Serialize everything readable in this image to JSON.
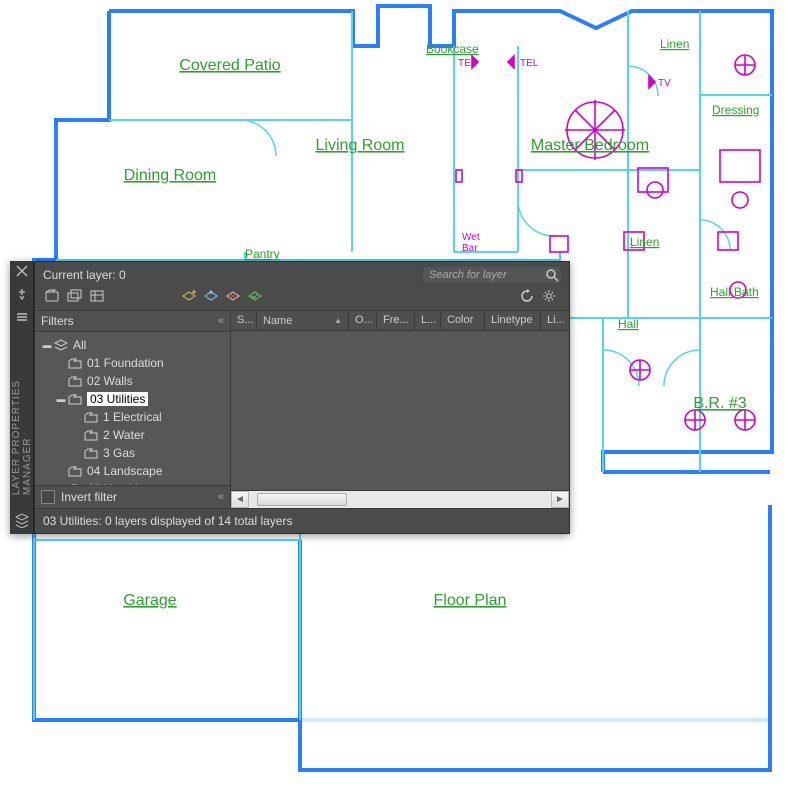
{
  "rooms": {
    "covered_patio": "Covered Patio",
    "living_room": "Living Room",
    "master_bedroom": "Master Bedroom",
    "dining_room": "Dining Room",
    "garage": "Garage",
    "floor_plan": "Floor Plan",
    "dressing": "Dressing",
    "hall_bath": "Hall Bath",
    "hall": "Hall",
    "br3": "B.R. #3",
    "linen1": "Linen",
    "linen2": "Linen",
    "bookcase": "Bookcase",
    "pantry": "Pantry",
    "wet_bar": "Wet\nBar",
    "tv": "TV",
    "tel1": "TEL",
    "tel2": "TEL"
  },
  "panel": {
    "title": "LAYER PROPERTIES MANAGER",
    "current_layer": "Current layer: 0",
    "search_placeholder": "Search for layer",
    "filters_heading": "Filters",
    "invert_filter": "Invert filter",
    "status": "03 Utilities: 0 layers displayed of 14 total layers",
    "tooltips": {
      "close": "Close",
      "pin": "Auto-hide",
      "menu": "Menu",
      "new_group": "New Group Filter",
      "new_prop": "New Property Filter",
      "states": "Layer States Manager",
      "new_layer": "New Layer",
      "new_frozen": "New Layer Frozen VP",
      "delete_layer": "Delete Layer",
      "set_current": "Set Current",
      "refresh": "Refresh",
      "settings": "Settings"
    },
    "columns": {
      "status": "S...",
      "name": "Name",
      "on": "O...",
      "freeze": "Fre...",
      "lock": "L...",
      "color": "Color",
      "linetype": "Linetype",
      "lineweight": "Li..."
    },
    "tree": {
      "root": "All",
      "n1": "01 Foundation",
      "n2": "02 Walls",
      "n3": "03 Utilities",
      "n3a": "1 Electrical",
      "n3b": "2 Water",
      "n3c": "3 Gas",
      "n4": "04 Landscape",
      "n5": "All Used Layers"
    }
  }
}
